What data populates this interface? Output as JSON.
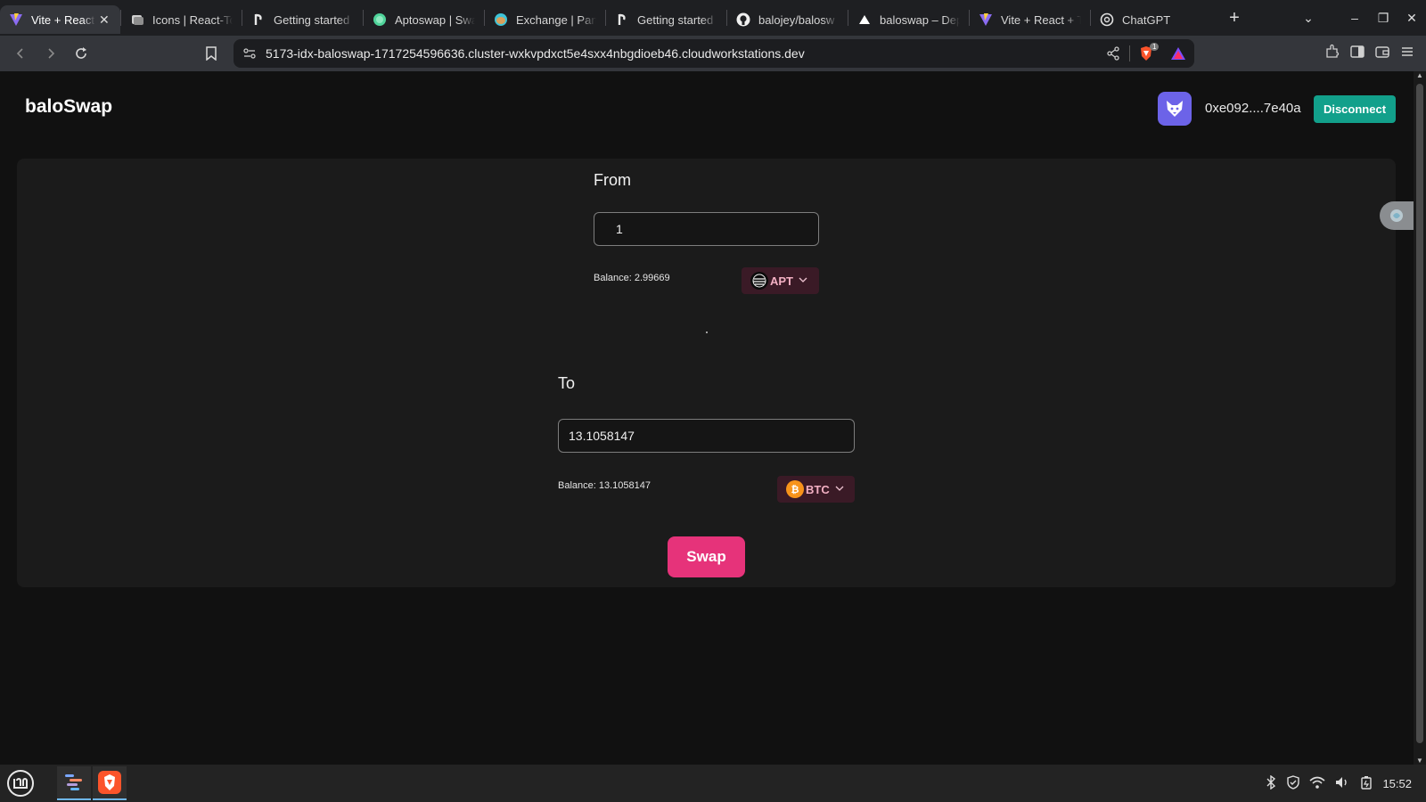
{
  "browser": {
    "tabs": [
      {
        "label": "Vite + React",
        "icon": "vite-icon",
        "active": true
      },
      {
        "label": "Icons | React-To",
        "icon": "react-icons-icon"
      },
      {
        "label": "Getting started",
        "icon": "ant-design-icon"
      },
      {
        "label": "Aptoswap | Swa",
        "icon": "aptoswap-icon"
      },
      {
        "label": "Exchange | Panc",
        "icon": "pancakeswap-icon"
      },
      {
        "label": "Getting started",
        "icon": "ant-design-icon"
      },
      {
        "label": "balojey/balosw",
        "icon": "github-icon"
      },
      {
        "label": "baloswap – Dep",
        "icon": "vercel-icon"
      },
      {
        "label": "Vite + React + T",
        "icon": "vite-icon"
      },
      {
        "label": "ChatGPT",
        "icon": "chatgpt-icon"
      }
    ],
    "url": "5173-idx-baloswap-1717254596636.cluster-wxkvpdxct5e4sxx4nbgdioeb46.cloudworkstations.dev",
    "brave_badge": "1"
  },
  "app": {
    "title": "baloSwap",
    "wallet_address": "0xe092....7e40a",
    "disconnect_label": "Disconnect",
    "from": {
      "label": "From",
      "amount": "1",
      "balance": "Balance: 2.99669",
      "token": "APT"
    },
    "to": {
      "label": "To",
      "amount": "13.1058147",
      "balance": "Balance: 13.1058147",
      "token": "BTC"
    },
    "swap_label": "Swap"
  },
  "taskbar": {
    "clock": "15:52"
  },
  "colors": {
    "accent_pink": "#e6337a",
    "disconnect_teal": "#12a08b",
    "wallet_purple": "#6c63e8",
    "token_bg": "#3a1a26",
    "btc_orange": "#f7931a"
  }
}
